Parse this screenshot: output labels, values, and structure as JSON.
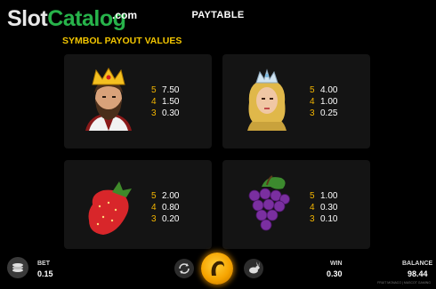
{
  "watermark": {
    "slot": "Slot",
    "catalog": "Catalog",
    "com": ".com"
  },
  "header": {
    "title": "PAYTABLE",
    "subtitle": "SYMBOL PAYOUT VALUES"
  },
  "symbols": [
    {
      "name": "king-symbol",
      "pays": [
        {
          "count": "5",
          "value": "7.50"
        },
        {
          "count": "4",
          "value": "1.50"
        },
        {
          "count": "3",
          "value": "0.30"
        }
      ]
    },
    {
      "name": "queen-symbol",
      "pays": [
        {
          "count": "5",
          "value": "4.00"
        },
        {
          "count": "4",
          "value": "1.00"
        },
        {
          "count": "3",
          "value": "0.25"
        }
      ]
    },
    {
      "name": "strawberry-symbol",
      "pays": [
        {
          "count": "5",
          "value": "2.00"
        },
        {
          "count": "4",
          "value": "0.80"
        },
        {
          "count": "3",
          "value": "0.20"
        }
      ]
    },
    {
      "name": "grapes-symbol",
      "pays": [
        {
          "count": "5",
          "value": "1.00"
        },
        {
          "count": "4",
          "value": "0.30"
        },
        {
          "count": "3",
          "value": "0.10"
        }
      ]
    }
  ],
  "footer": {
    "bet_label": "BET",
    "bet_value": "0.15",
    "win_label": "WIN",
    "win_value": "0.30",
    "balance_label": "BALANCE",
    "balance_value": "98.44",
    "legal": "FRUIT MONACO | MASCOT GAMING"
  },
  "colors": {
    "accent": "#f2c500",
    "watermark_green": "#27b34a",
    "card_bg": "#141414"
  },
  "icons": [
    "chips-icon",
    "autoplay-icon",
    "spin-icon",
    "turbo-rabbit-icon"
  ]
}
